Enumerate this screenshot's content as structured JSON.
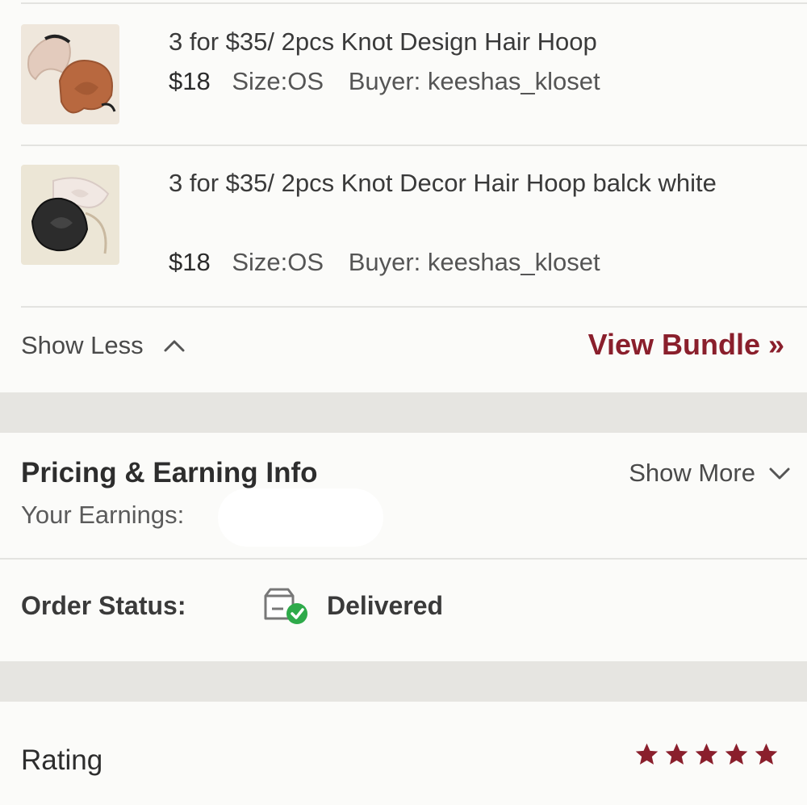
{
  "items": [
    {
      "title": "3 for $35/ 2pcs Knot Design Hair Hoop",
      "price": "$18",
      "size": "Size:OS",
      "buyer": "Buyer: keeshas_kloset"
    },
    {
      "title": "3 for $35/ 2pcs Knot Decor Hair Hoop balck white",
      "price": "$18",
      "size": "Size:OS",
      "buyer": "Buyer: keeshas_kloset"
    }
  ],
  "bundle": {
    "show_less": "Show Less",
    "view_bundle": "View Bundle »"
  },
  "pricing": {
    "title": "Pricing & Earning Info",
    "show_more": "Show More",
    "earnings_label": "Your Earnings:"
  },
  "order": {
    "status_label": "Order Status:",
    "status_value": "Delivered"
  },
  "rating": {
    "label": "Rating",
    "stars": 5
  },
  "colors": {
    "accent": "#8a1f2c",
    "success": "#2eaa4a",
    "section_gap": "#e6e5e1"
  }
}
